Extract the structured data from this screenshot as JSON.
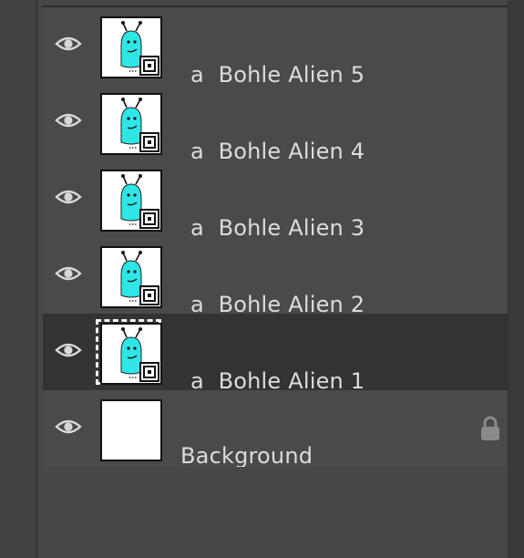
{
  "layers": [
    {
      "prefix": "a",
      "name": "Bohle Alien 5",
      "selected": false
    },
    {
      "prefix": "a",
      "name": "Bohle Alien 4",
      "selected": false
    },
    {
      "prefix": "a",
      "name": "Bohle Alien 3",
      "selected": false
    },
    {
      "prefix": "a",
      "name": "Bohle Alien 2",
      "selected": false
    },
    {
      "prefix": "a",
      "name": "Bohle Alien 1",
      "selected": true
    }
  ],
  "background_layer": {
    "name": "Background",
    "locked": true
  },
  "icons": {
    "visibility": "eye-icon",
    "lock": "lock-icon",
    "smart_object": "smart-object-badge-icon"
  },
  "colors": {
    "alien": "#2ee6e6",
    "panel": "#4a4a4a",
    "selected_row": "#333333",
    "text": "#dcdcdc"
  }
}
